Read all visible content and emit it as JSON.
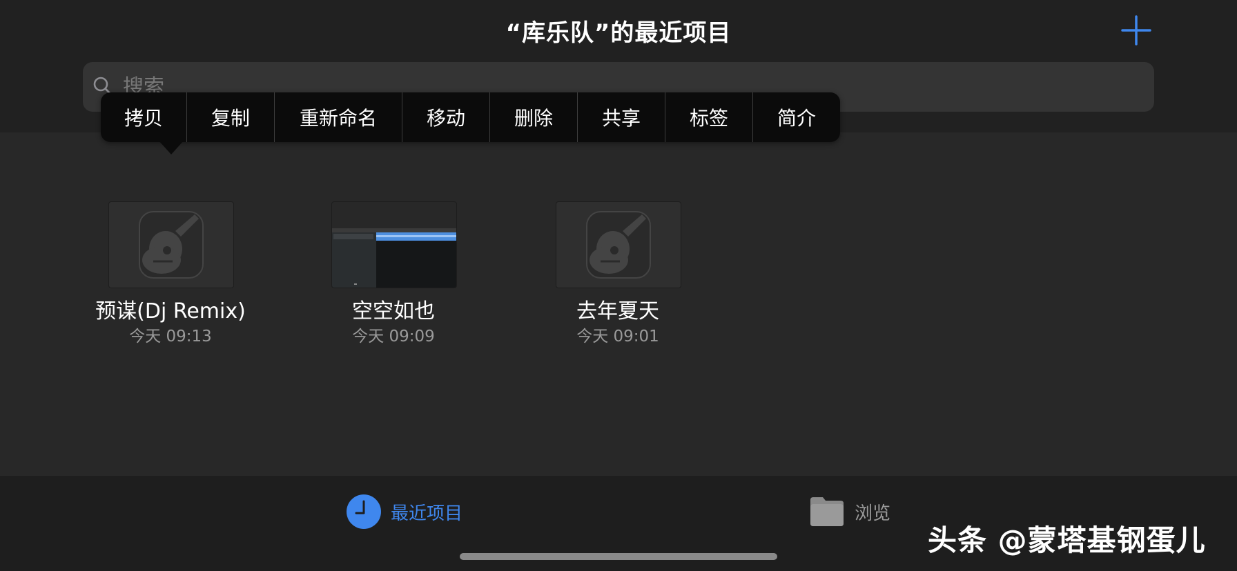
{
  "header": {
    "title": "“库乐队”的最近项目",
    "add_icon": "plus-icon",
    "accent": "#3f87ee"
  },
  "search": {
    "placeholder": "搜索",
    "icon": "search-icon"
  },
  "context_menu": {
    "items": [
      {
        "label": "拷贝"
      },
      {
        "label": "复制"
      },
      {
        "label": "重新命名"
      },
      {
        "label": "移动"
      },
      {
        "label": "删除"
      },
      {
        "label": "共享"
      },
      {
        "label": "标签"
      },
      {
        "label": "简介"
      }
    ]
  },
  "projects": [
    {
      "name": "预谋(Dj Remix)",
      "date": "今天 09:13",
      "thumbnail": "garageband-guitar-icon"
    },
    {
      "name": "空空如也",
      "date": "今天 09:09",
      "thumbnail": "tracks-preview"
    },
    {
      "name": "去年夏天",
      "date": "今天 09:01",
      "thumbnail": "garageband-guitar-icon"
    }
  ],
  "tabs": [
    {
      "label": "最近项目",
      "icon": "clock-icon",
      "active": true
    },
    {
      "label": "浏览",
      "icon": "folder-icon",
      "active": false
    }
  ],
  "watermark": "头条 @蒙塔基钢蛋儿"
}
